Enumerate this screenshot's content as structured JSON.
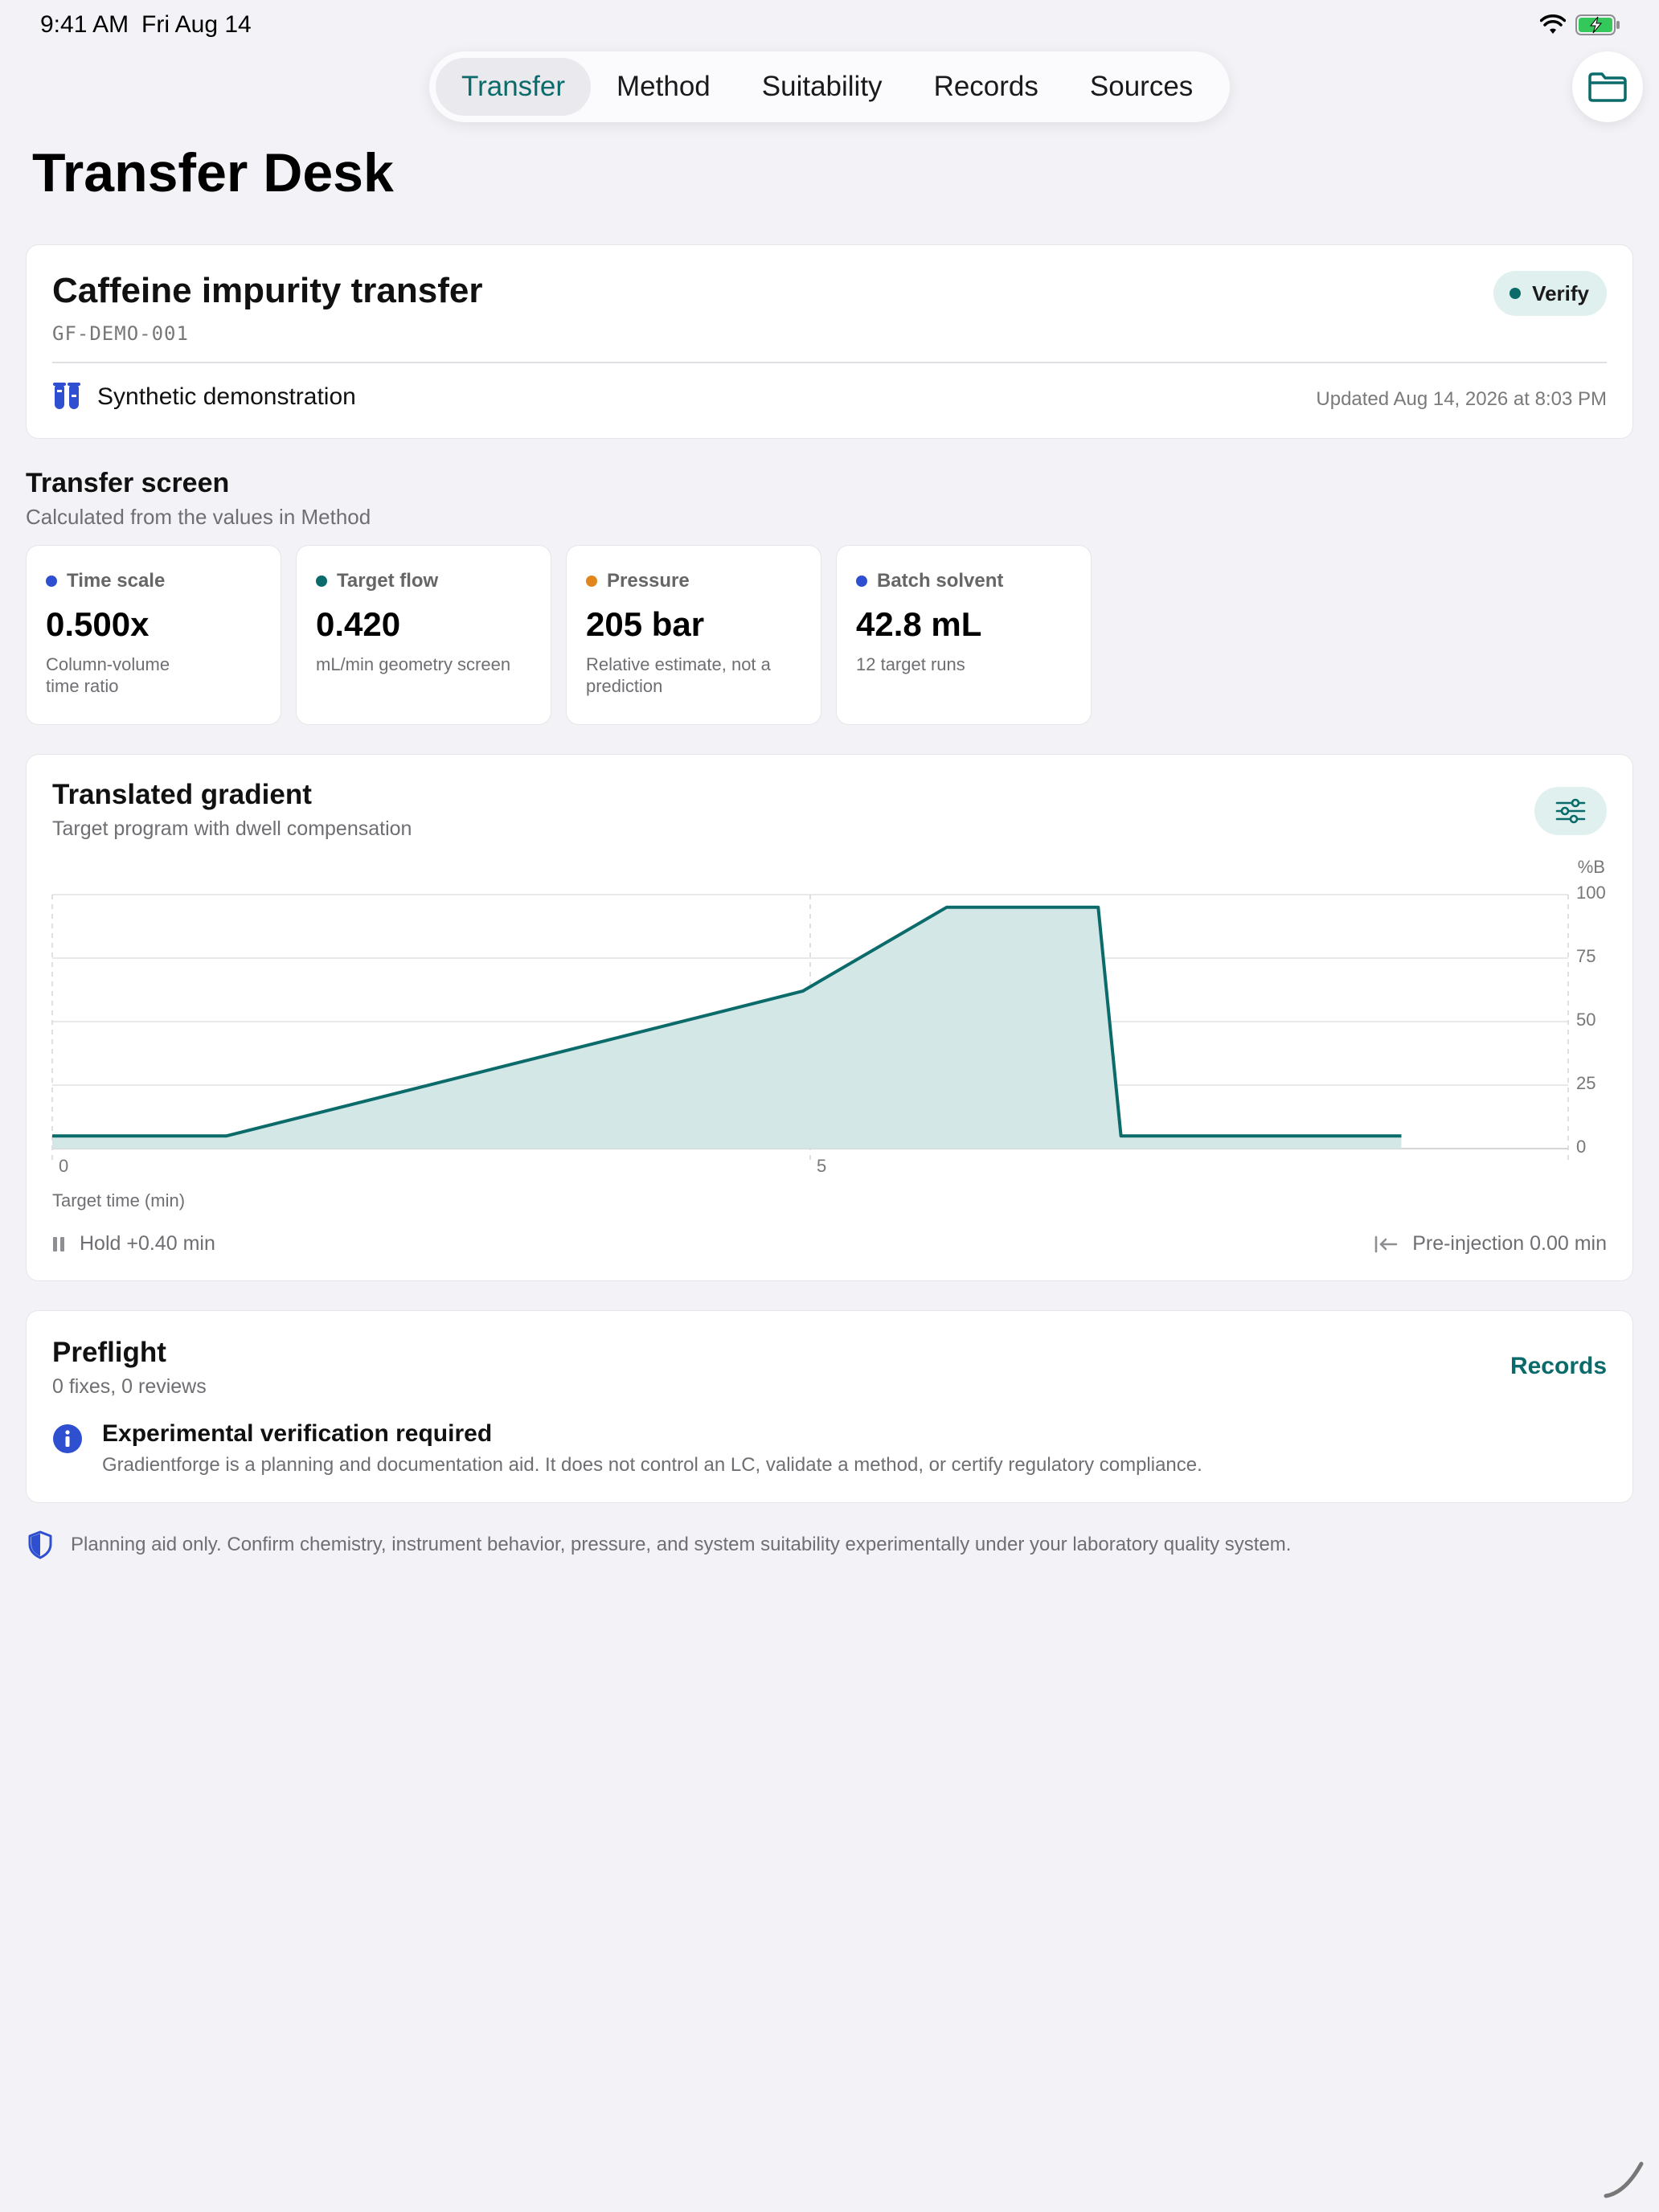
{
  "status": {
    "time": "9:41 AM",
    "date": "Fri Aug 14"
  },
  "tabs": [
    {
      "label": "Transfer",
      "active": true
    },
    {
      "label": "Method"
    },
    {
      "label": "Suitability"
    },
    {
      "label": "Records"
    },
    {
      "label": "Sources"
    }
  ],
  "page": {
    "title": "Transfer Desk"
  },
  "project": {
    "title": "Caffeine impurity transfer",
    "id": "GF-DEMO-001",
    "badge": "Verify",
    "source": "Synthetic demonstration",
    "updated": "Updated Aug 14, 2026 at 8:03 PM"
  },
  "screen": {
    "title": "Transfer screen",
    "subtitle": "Calculated from the values in Method",
    "metrics": [
      {
        "label": "Time scale",
        "value": "0.500x",
        "note": "Column-volume time ratio",
        "color": "#2f4fd1"
      },
      {
        "label": "Target flow",
        "value": "0.420",
        "note": "mL/min geometry screen",
        "color": "#0b6b6b"
      },
      {
        "label": "Pressure",
        "value": "205 bar",
        "note": "Relative estimate, not a prediction",
        "color": "#e0861a"
      },
      {
        "label": "Batch solvent",
        "value": "42.8 mL",
        "note": "12 target runs",
        "color": "#2f4fd1"
      }
    ]
  },
  "gradient": {
    "title": "Translated gradient",
    "subtitle": "Target program with dwell compensation",
    "hold": "Hold +0.40 min",
    "preinjection": "Pre-injection 0.00 min"
  },
  "chart_data": {
    "type": "area",
    "xlabel": "Target time (min)",
    "ylabel": "%B",
    "xlim": [
      0,
      10
    ],
    "ylim": [
      0,
      100
    ],
    "x_ticks": [
      "0",
      "5"
    ],
    "y_ticks": [
      "100",
      "75",
      "50",
      "25",
      "0"
    ],
    "points": [
      {
        "x": 0,
        "y": 5
      },
      {
        "x": 1.15,
        "y": 5
      },
      {
        "x": 4.95,
        "y": 62
      },
      {
        "x": 5.9,
        "y": 95
      },
      {
        "x": 6.9,
        "y": 95
      },
      {
        "x": 7.05,
        "y": 5
      },
      {
        "x": 8.9,
        "y": 5
      }
    ],
    "line_color": "#0b6b6b",
    "fill_color": "#d3e8e6",
    "grid": true
  },
  "preflight": {
    "title": "Preflight",
    "subtitle": "0 fixes, 0 reviews",
    "link": "Records",
    "item_title": "Experimental verification required",
    "item_text": "Gradientforge is a planning and documentation aid. It does not control an LC, validate a method, or certify regulatory compliance."
  },
  "disclaimer": "Planning aid only. Confirm chemistry, instrument behavior, pressure, and system suitability experimentally under your laboratory quality system."
}
